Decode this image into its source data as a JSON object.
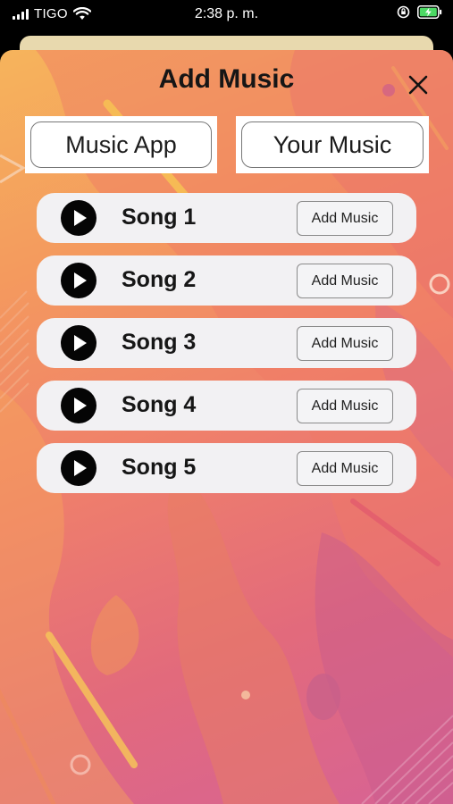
{
  "status_bar": {
    "carrier": "TIGO",
    "time": "2:38 p. m.",
    "signal_icon": "signal-bars-icon",
    "wifi_icon": "wifi-icon",
    "lock_icon": "orientation-lock-icon",
    "battery_icon": "battery-charging-icon"
  },
  "modal": {
    "title": "Add Music",
    "close_icon": "close-icon"
  },
  "sources": {
    "music_app": "Music App",
    "your_music": "Your Music"
  },
  "songs": [
    {
      "title": "Song 1",
      "action": "Add Music"
    },
    {
      "title": "Song 2",
      "action": "Add Music"
    },
    {
      "title": "Song 3",
      "action": "Add Music"
    },
    {
      "title": "Song 4",
      "action": "Add Music"
    },
    {
      "title": "Song 5",
      "action": "Add Music"
    }
  ],
  "colors": {
    "gradient_start": "#f6b45c",
    "gradient_end": "#d76394",
    "row_background": "#f2f1f3",
    "battery_green": "#4cd964"
  }
}
